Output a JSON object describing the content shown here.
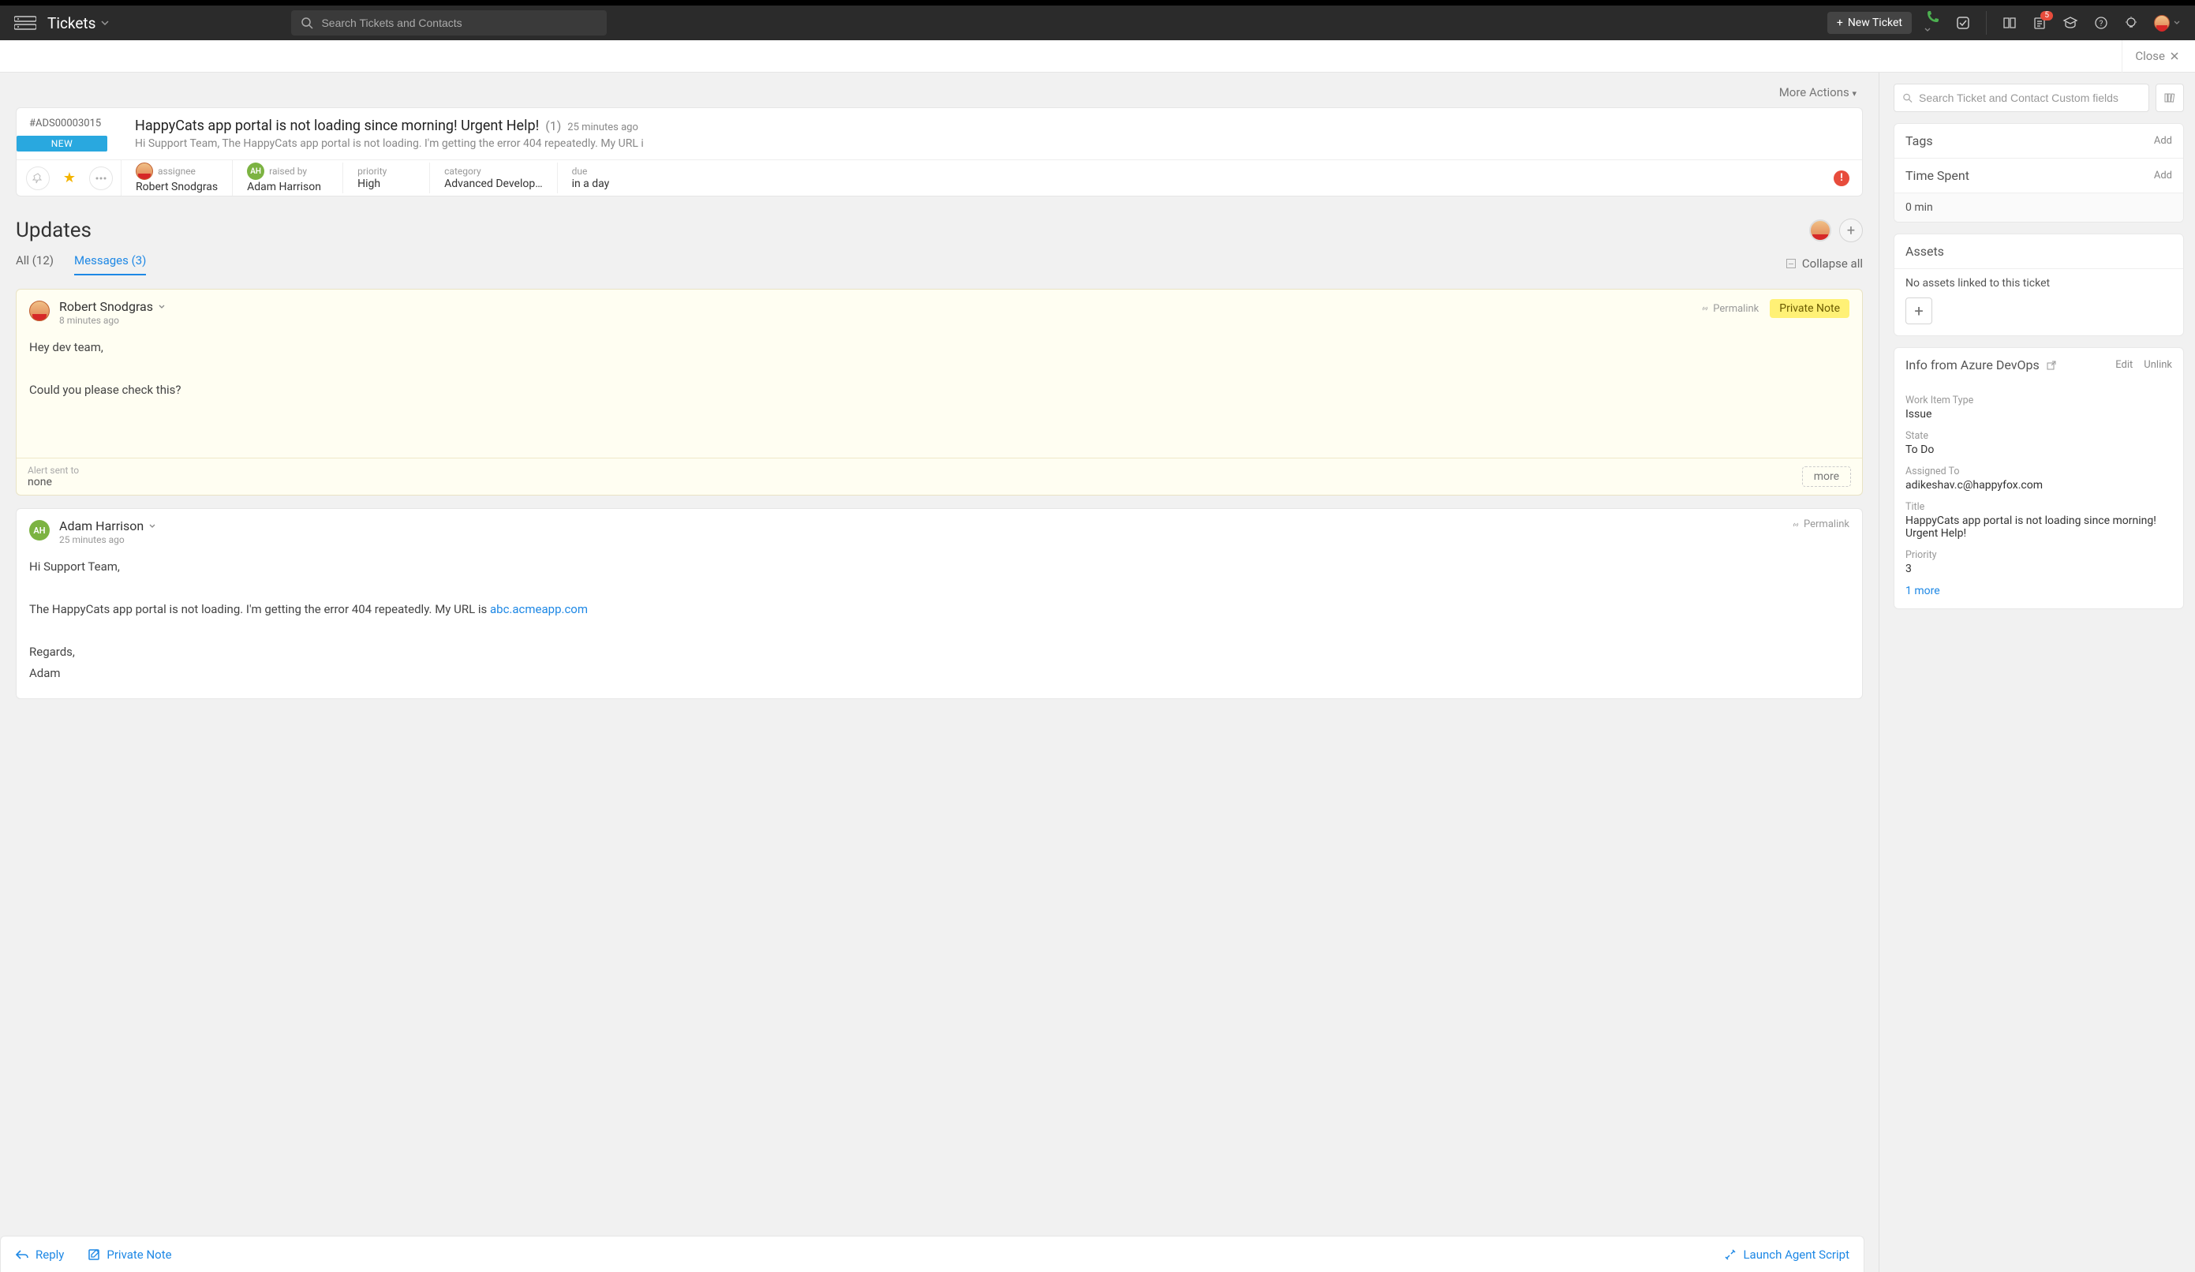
{
  "header": {
    "section": "Tickets",
    "search_placeholder": "Search Tickets and Contacts",
    "new_ticket_label": "New Ticket",
    "notification_count": "5"
  },
  "closebar": {
    "close_label": "Close"
  },
  "more_actions_label": "More Actions",
  "ticket": {
    "id": "#ADS00003015",
    "status": "NEW",
    "title": "HappyCats app portal is not loading since morning! Urgent Help!",
    "count": "(1)",
    "age": "25 minutes ago",
    "preview": "Hi Support Team, The HappyCats app portal is not loading. I'm getting the error 404 repeatedly. My URL i",
    "meta": {
      "assignee_label": "assignee",
      "assignee": "Robert Snodgras",
      "raised_by_label": "raised by",
      "raised_by": "Adam Harrison",
      "raised_by_initials": "AH",
      "priority_label": "priority",
      "priority": "High",
      "category_label": "category",
      "category": "Advanced Develop…",
      "due_label": "due",
      "due": "in a day"
    }
  },
  "updates": {
    "heading": "Updates",
    "tabs": {
      "all": "All (12)",
      "messages": "Messages (3)"
    },
    "collapse_label": "Collapse all"
  },
  "messages": [
    {
      "author": "Robert Snodgras",
      "time": "8 minutes ago",
      "permalink_label": "Permalink",
      "badge": "Private Note",
      "body_lines": [
        "Hey dev team,",
        "",
        "Could you please check this?"
      ],
      "alert_label": "Alert sent to",
      "alert_value": "none",
      "more_label": "more"
    },
    {
      "author": "Adam Harrison",
      "initials": "AH",
      "time": "25 minutes ago",
      "permalink_label": "Permalink",
      "body_prefix": "Hi Support Team,",
      "body_main": "The HappyCats app portal is not loading. I'm getting the error 404 repeatedly. My URL is ",
      "body_link": "abc.acmeapp.com",
      "body_sign1": "Regards,",
      "body_sign2": "Adam"
    }
  ],
  "action_bar": {
    "reply": "Reply",
    "private_note": "Private Note",
    "launch_agent": "Launch Agent Script"
  },
  "sidebar": {
    "search_placeholder": "Search Ticket and Contact Custom fields",
    "tags": {
      "title": "Tags",
      "add": "Add"
    },
    "time_spent": {
      "title": "Time Spent",
      "add": "Add",
      "value": "0 min"
    },
    "assets": {
      "title": "Assets",
      "empty": "No assets linked to this ticket"
    },
    "devops": {
      "title": "Info from Azure DevOps",
      "edit": "Edit",
      "unlink": "Unlink",
      "fields": [
        {
          "lbl": "Work Item Type",
          "val": "Issue"
        },
        {
          "lbl": "State",
          "val": "To Do"
        },
        {
          "lbl": "Assigned To",
          "val": "adikeshav.c@happyfox.com"
        },
        {
          "lbl": "Title",
          "val": "HappyCats app portal is not loading since morning! Urgent Help!"
        },
        {
          "lbl": "Priority",
          "val": "3"
        }
      ],
      "more": "1 more"
    }
  }
}
